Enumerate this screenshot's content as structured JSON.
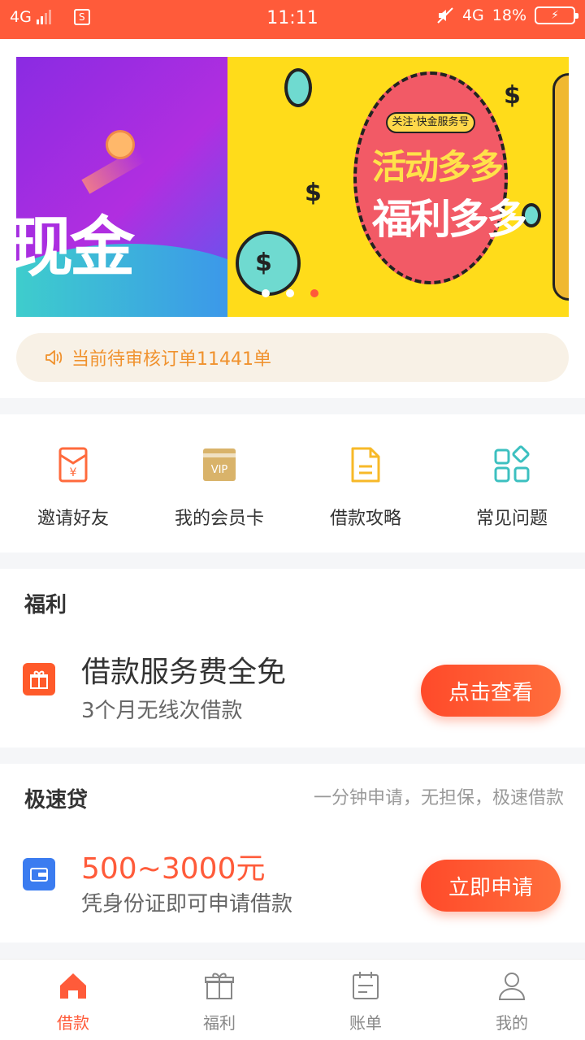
{
  "status_bar": {
    "network": "4G",
    "time": "11:11",
    "network_right": "4G",
    "battery_percent": "18%"
  },
  "banner": {
    "slide_a_text": "现金",
    "slide_b_tag": "关注·快金服务号",
    "slide_b_line1": "活动多多",
    "slide_b_line2": "福利多多",
    "dollar_glyph": "$",
    "active_dot": 2
  },
  "notice": {
    "text": "当前待审核订单11441单"
  },
  "menu": {
    "items": [
      {
        "label": "邀请好友",
        "icon": "red-envelope-icon",
        "color": "#ff6a3c"
      },
      {
        "label": "我的会员卡",
        "icon": "vip-card-icon",
        "color": "#d9b36a"
      },
      {
        "label": "借款攻略",
        "icon": "document-icon",
        "color": "#f7b928"
      },
      {
        "label": "常见问题",
        "icon": "grid-apps-icon",
        "color": "#3cc0c0"
      }
    ]
  },
  "welfare": {
    "title": "福利",
    "headline": "借款服务费全免",
    "desc": "3个月无线次借款",
    "button": "点击查看",
    "icon": "gift-icon"
  },
  "fast_loan": {
    "title": "极速贷",
    "subtitle": "一分钟申请，无担保，极速借款",
    "amount": "500~3000元",
    "desc": "凭身份证即可申请借款",
    "button": "立即申请",
    "icon": "wallet-icon",
    "amount_color": "#ff5b3a"
  },
  "tabbar": {
    "tabs": [
      {
        "label": "借款",
        "icon": "home-icon",
        "active": true
      },
      {
        "label": "福利",
        "icon": "gift-icon",
        "active": false
      },
      {
        "label": "账单",
        "icon": "calendar-bill-icon",
        "active": false
      },
      {
        "label": "我的",
        "icon": "user-icon",
        "active": false
      }
    ]
  },
  "colors": {
    "brand": "#ff5b3a",
    "notice_text": "#f0922e"
  }
}
